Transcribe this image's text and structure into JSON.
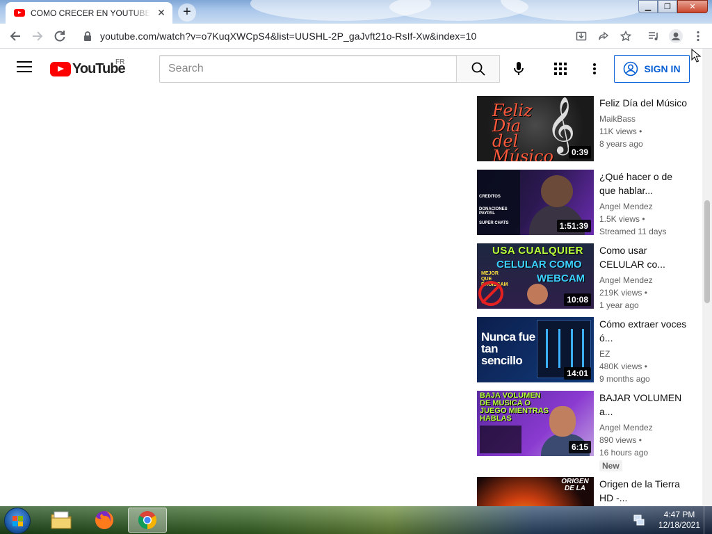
{
  "browser": {
    "tab_title": "COMO CRECER EN YOUTUBE - Y",
    "tab_close": "✕",
    "new_tab": "+",
    "url": "youtube.com/watch?v=o7KuqXWCpS4&list=UUSHL-2P_gaJvft21o-RsIf-Xw&index=10",
    "window_controls": {
      "minimize": "▁",
      "maximize": "❐",
      "close": "✕"
    }
  },
  "header": {
    "logo_text": "YouTube",
    "region": "FR",
    "search_placeholder": "Search",
    "signin_label": "SIGN IN"
  },
  "thumb_text": {
    "v1": "Feliz Día del Músico",
    "v2_panel": [
      "CREDITOS",
      "DONACIONES PAYPAL",
      "SUPER CHATS"
    ],
    "v3_line1": "USA CUALQUIER",
    "v3_line2": "CELULAR COMO",
    "v3_line3": "WEBCAM",
    "v3_mini": "MEJOR QUE DROIDCAM",
    "v4": "Nunca fue tan sencillo",
    "v5": "BAJA VOLUMEN DE MUSICA O JUEGO MIENTRAS HABLAS",
    "v6": "ORIGEN DE LA"
  },
  "videos": [
    {
      "title": "Feliz Día del Músico",
      "channel": "MaikBass",
      "views": "11K views •",
      "age": "8 years ago",
      "duration": "0:39",
      "badge": ""
    },
    {
      "title": "¿Qué hacer o de que hablar...",
      "channel": "Angel Mendez",
      "views": "1.5K views •",
      "age": "Streamed 11 days",
      "duration": "1:51:39",
      "badge": ""
    },
    {
      "title": "Como usar CELULAR co...",
      "channel": "Angel Mendez",
      "views": "219K views •",
      "age": "1 year ago",
      "duration": "10:08",
      "badge": ""
    },
    {
      "title": "Cómo extraer voces ó...",
      "channel": "EZ",
      "views": "480K views •",
      "age": "9 months ago",
      "duration": "14:01",
      "badge": ""
    },
    {
      "title": "BAJAR VOLUMEN a...",
      "channel": "Angel Mendez",
      "views": "890 views •",
      "age": "16 hours ago",
      "duration": "6:15",
      "badge": "New"
    },
    {
      "title": "Origen de la Tierra HD -...",
      "channel": "",
      "views": "",
      "age": "",
      "duration": "",
      "badge": ""
    }
  ],
  "taskbar": {
    "time": "4:47 PM",
    "date": "12/18/2021"
  },
  "colors": {
    "accent_blue": "#065fd4",
    "youtube_red": "#ff0000"
  }
}
